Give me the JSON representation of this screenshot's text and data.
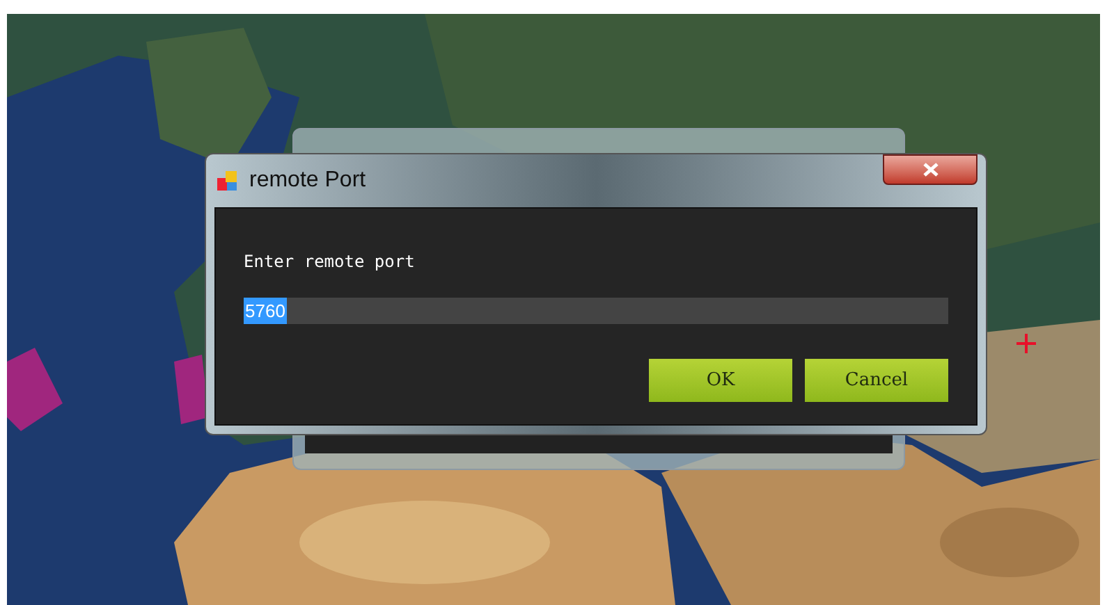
{
  "dialog": {
    "title": "remote Port",
    "label": "Enter remote port",
    "input": {
      "value": "5760",
      "text_selected": true
    },
    "buttons": [
      {
        "label": "OK"
      },
      {
        "label": "Cancel"
      }
    ]
  }
}
